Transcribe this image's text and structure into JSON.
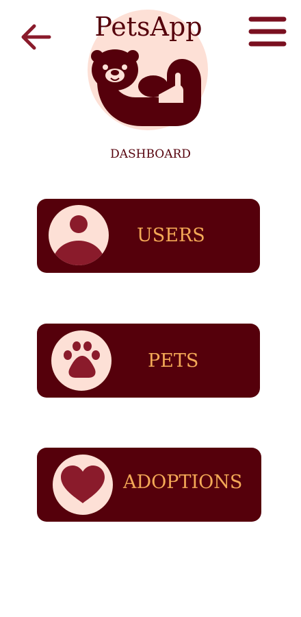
{
  "header": {
    "title": "PetsApp",
    "subtitle": "DASHBOARD",
    "back_icon": "arrow-left-icon",
    "menu_icon": "hamburger-menu-icon",
    "logo_icon": "otter-logo"
  },
  "menu": [
    {
      "label": "USERS",
      "icon": "user-avatar-icon"
    },
    {
      "label": "PETS",
      "icon": "paw-icon"
    },
    {
      "label": "ADOPTIONS",
      "icon": "heart-icon"
    }
  ],
  "colors": {
    "primary": "#55000b",
    "accent_text": "#f4a957",
    "icon_bg": "#fde0d6",
    "icon_fg": "#8a1b2b",
    "background": "#ffffff"
  }
}
